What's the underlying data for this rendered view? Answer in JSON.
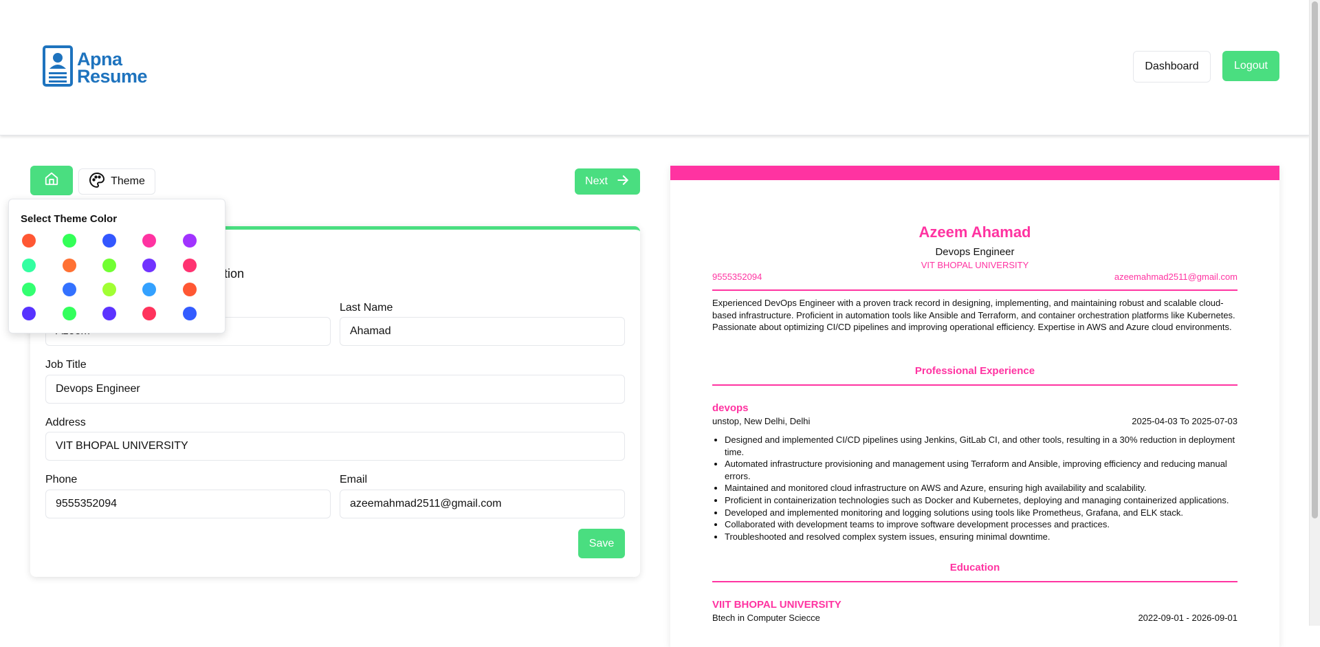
{
  "header": {
    "logo_line1": "Apna",
    "logo_line2": "Resume",
    "dashboard_label": "Dashboard",
    "logout_label": "Logout"
  },
  "toolbar": {
    "home_icon": "home-icon",
    "theme_label": "Theme",
    "next_label": "Next"
  },
  "theme_popover": {
    "title": "Select Theme Color",
    "colors": [
      "#FF5733",
      "#33FF57",
      "#3357FF",
      "#FF33A1",
      "#A133FF",
      "#33FFA1",
      "#FF7133",
      "#71FF33",
      "#7133FF",
      "#FF3371",
      "#33FF71",
      "#3371FF",
      "#A1FF33",
      "#33A1FF",
      "#FF5733",
      "#5733FF",
      "#33FF5C",
      "#5C33FF",
      "#FF335C",
      "#335CFF"
    ]
  },
  "form": {
    "heading_partial": "ation",
    "first_name_value": "Azeem",
    "last_name_label": "Last Name",
    "last_name_value": "Ahamad",
    "job_title_label": "Job Title",
    "job_title_value": "Devops Engineer",
    "address_label": "Address",
    "address_value": "VIT BHOPAL UNIVERSITY",
    "phone_label": "Phone",
    "phone_value": "9555352094",
    "email_label": "Email",
    "email_value": "azeemahmad2511@gmail.com",
    "save_label": "Save"
  },
  "resume": {
    "theme_color": "#FF33A1",
    "name": "Azeem Ahamad",
    "job_title": "Devops Engineer",
    "address": "VIT BHOPAL UNIVERSITY",
    "phone": "9555352094",
    "email": "azeemahmad2511@gmail.com",
    "summary": "Experienced DevOps Engineer with a proven track record in designing, implementing, and maintaining robust and scalable cloud-based infrastructure. Proficient in automation tools like Ansible and Terraform, and container orchestration platforms like Kubernetes. Passionate about optimizing CI/CD pipelines and improving operational efficiency. Expertise in AWS and Azure cloud environments.",
    "experience_heading": "Professional Experience",
    "experience": {
      "title": "devops",
      "company": "unstop, New Delhi, Delhi",
      "dates": "2025-04-03 To 2025-07-03",
      "bullets": [
        "Designed and implemented CI/CD pipelines using Jenkins, GitLab CI, and other tools, resulting in a 30% reduction in deployment time.",
        "Automated infrastructure provisioning and management using Terraform and Ansible, improving efficiency and reducing manual errors.",
        "Maintained and monitored cloud infrastructure on AWS and Azure, ensuring high availability and scalability.",
        "Proficient in containerization technologies such as Docker and Kubernetes, deploying and managing containerized applications.",
        "Developed and implemented monitoring and logging solutions using tools like Prometheus, Grafana, and ELK stack.",
        "Collaborated with development teams to improve software development processes and practices.",
        "Troubleshooted and resolved complex system issues, ensuring minimal downtime."
      ]
    },
    "education_heading": "Education",
    "education": {
      "school": "VIIT BHOPAL UNIVERSITY",
      "degree": "Btech in Computer Sciecce",
      "dates": "2022-09-01 - 2026-09-01"
    }
  }
}
